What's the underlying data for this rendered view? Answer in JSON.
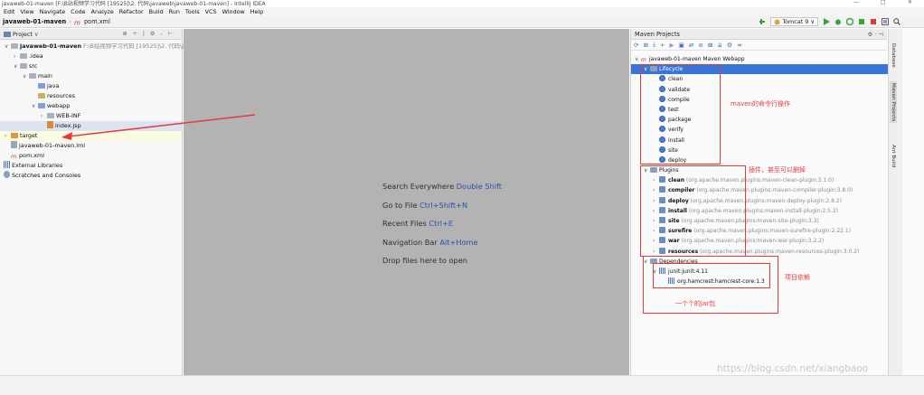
{
  "window": {
    "title": "javaweb-01-maven [F:\\B站视频学习代码 [19525]\\2. 代码\\javaweb\\javaweb-01-maven] - IntelliJ IDEA",
    "controls": [
      "—",
      "□",
      "✕"
    ]
  },
  "menu": [
    "Edit",
    "View",
    "Navigate",
    "Code",
    "Analyze",
    "Refactor",
    "Build",
    "Run",
    "Tools",
    "VCS",
    "Window",
    "Help"
  ],
  "breadcrumb": {
    "project": "javaweb-01-maven",
    "file": "pom.xml"
  },
  "toolbar": {
    "run_config": "Tomcat 9"
  },
  "project_panel": {
    "title": "Project",
    "tree": [
      {
        "label": "javaweb-01-maven",
        "suffix": " F:\\B站视频学习代码 [19525]\\2. 代码\\java",
        "depth": 0,
        "arrow": "∨",
        "icon": "gray",
        "bold": true
      },
      {
        "label": ".idea",
        "depth": 1,
        "arrow": "›",
        "icon": "gray"
      },
      {
        "label": "src",
        "depth": 1,
        "arrow": "∨",
        "icon": "gray"
      },
      {
        "label": "main",
        "depth": 2,
        "arrow": "∨",
        "icon": "gray"
      },
      {
        "label": "java",
        "depth": 3,
        "arrow": "",
        "icon": "blue"
      },
      {
        "label": "resources",
        "depth": 3,
        "arrow": "",
        "icon": "tan"
      },
      {
        "label": "webapp",
        "depth": 3,
        "arrow": "∨",
        "icon": "blue"
      },
      {
        "label": "WEB-INF",
        "depth": 4,
        "arrow": "›",
        "icon": "gray"
      },
      {
        "label": "index.jsp",
        "depth": 4,
        "arrow": "",
        "icon": "file-jsp",
        "selected": true
      },
      {
        "label": "target",
        "depth": 0,
        "arrow": "›",
        "icon": "orange",
        "highlighted": true
      },
      {
        "label": "javaweb-01-maven.iml",
        "depth": 0,
        "arrow": "",
        "icon": "file-iml"
      },
      {
        "label": "pom.xml",
        "depth": 0,
        "arrow": "",
        "icon": "file-maven"
      },
      {
        "label": "External Libraries",
        "depth": -1,
        "arrow": "",
        "icon": "lib"
      },
      {
        "label": "Scratches and Consoles",
        "depth": -1,
        "arrow": "",
        "icon": "scratch"
      }
    ]
  },
  "editor": {
    "hints": [
      {
        "text": "Search Everywhere ",
        "key": "Double Shift"
      },
      {
        "text": "Go to File ",
        "key": "Ctrl+Shift+N"
      },
      {
        "text": "Recent Files ",
        "key": "Ctrl+E"
      },
      {
        "text": "Navigation Bar ",
        "key": "Alt+Home"
      },
      {
        "text": "Drop files here to open",
        "key": ""
      }
    ]
  },
  "maven_panel": {
    "title": "Maven Projects",
    "tree": [
      {
        "label": "javaweb-01-maven Maven Webapp",
        "depth": 0,
        "arrow": "∨",
        "icon": "maven"
      },
      {
        "label": "Lifecycle",
        "depth": 1,
        "arrow": "∨",
        "icon": "folder",
        "selected": true
      },
      {
        "label": "clean",
        "depth": 2,
        "icon": "gear"
      },
      {
        "label": "validate",
        "depth": 2,
        "icon": "gear"
      },
      {
        "label": "compile",
        "depth": 2,
        "icon": "gear"
      },
      {
        "label": "test",
        "depth": 2,
        "icon": "gear"
      },
      {
        "label": "package",
        "depth": 2,
        "icon": "gear"
      },
      {
        "label": "verify",
        "depth": 2,
        "icon": "gear"
      },
      {
        "label": "install",
        "depth": 2,
        "icon": "gear"
      },
      {
        "label": "site",
        "depth": 2,
        "icon": "gear"
      },
      {
        "label": "deploy",
        "depth": 2,
        "icon": "gear"
      },
      {
        "label": "Plugins",
        "depth": 1,
        "arrow": "∨",
        "icon": "folder"
      },
      {
        "label": "clean",
        "detail": " (org.apache.maven.plugins:maven-clean-plugin:3.1.0)",
        "depth": 2,
        "arrow": "›",
        "icon": "plug"
      },
      {
        "label": "compiler",
        "detail": " (org.apache.maven.plugins:maven-compiler-plugin:3.8.0)",
        "depth": 2,
        "arrow": "›",
        "icon": "plug"
      },
      {
        "label": "deploy",
        "detail": " (org.apache.maven.plugins:maven-deploy-plugin:2.8.2)",
        "depth": 2,
        "arrow": "›",
        "icon": "plug"
      },
      {
        "label": "install",
        "detail": " (org.apache.maven.plugins:maven-install-plugin:2.5.2)",
        "depth": 2,
        "arrow": "›",
        "icon": "plug"
      },
      {
        "label": "site",
        "detail": " (org.apache.maven.plugins:maven-site-plugin:3.3)",
        "depth": 2,
        "arrow": "›",
        "icon": "plug"
      },
      {
        "label": "surefire",
        "detail": " (org.apache.maven.plugins:maven-surefire-plugin:2.22.1)",
        "depth": 2,
        "arrow": "›",
        "icon": "plug"
      },
      {
        "label": "war",
        "detail": " (org.apache.maven.plugins:maven-war-plugin:3.2.2)",
        "depth": 2,
        "arrow": "›",
        "icon": "plug"
      },
      {
        "label": "resources",
        "detail": " (org.apache.maven.plugins:maven-resources-plugin:3.0.2)",
        "depth": 2,
        "arrow": "›",
        "icon": "plug"
      },
      {
        "label": "Dependencies",
        "depth": 1,
        "arrow": "∨",
        "icon": "folder"
      },
      {
        "label": "junit:junit:4.11",
        "depth": 2,
        "arrow": "∨",
        "icon": "lib"
      },
      {
        "label": "org.hamcrest:hamcrest-core:1.3",
        "depth": 3,
        "arrow": "",
        "icon": "lib"
      }
    ]
  },
  "side_tabs": [
    "Database",
    "Maven Projects",
    "Ant Build"
  ],
  "annotations": {
    "lifecycle_note": "maven的命令行操作",
    "plugins_note": "插件，甚至可以删掉",
    "deps_note": "项目依赖",
    "jar_note": "一个个的jar包"
  },
  "watermark": "https://blog.csdn.net/xiangbaoo",
  "colors": {
    "annotation_red": "#e43a3a",
    "selection_blue": "#3875d7",
    "editor_gray": "#b3b3b3"
  }
}
